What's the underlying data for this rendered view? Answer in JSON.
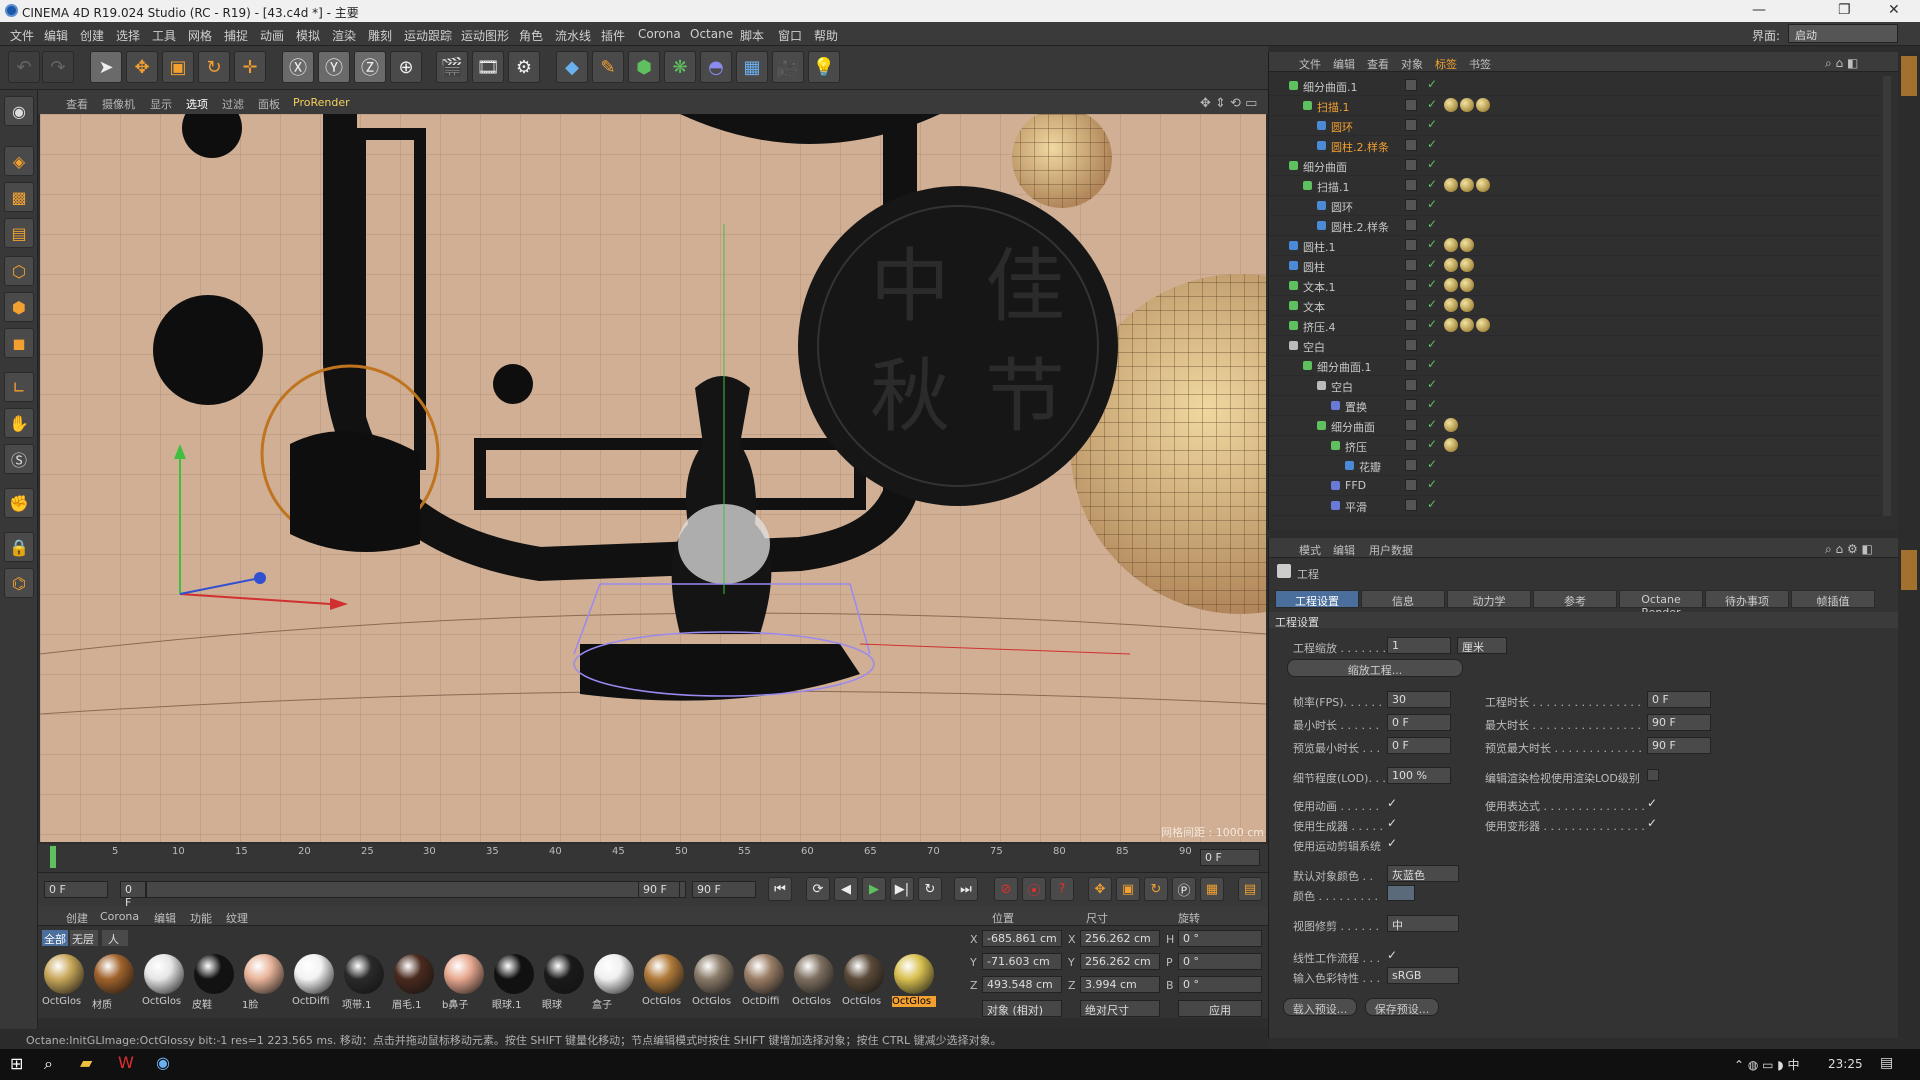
{
  "title": "CINEMA 4D R19.024 Studio (RC - R19) - [43.c4d *] - 主要",
  "window_controls": {
    "minimize": "—",
    "maximize": "❐",
    "close": "✕"
  },
  "menu": {
    "items": [
      "文件",
      "编辑",
      "创建",
      "选择",
      "工具",
      "网格",
      "捕捉",
      "动画",
      "模拟",
      "渲染",
      "雕刻",
      "运动跟踪",
      "运动图形",
      "角色",
      "流水线",
      "插件",
      "Corona",
      "Octane",
      "脚本",
      "窗口",
      "帮助"
    ],
    "layout_label": "界面:",
    "layout_value": "启动"
  },
  "viewport": {
    "menu": [
      "查看",
      "摄像机",
      "显示",
      "选项",
      "过滤",
      "面板",
      "ProRender"
    ],
    "grid_label": "网格间距 : 1000 cm",
    "calligraphy": [
      "中",
      "秋",
      "佳",
      "节"
    ]
  },
  "timeline": {
    "ticks": [
      "0",
      "5",
      "10",
      "15",
      "20",
      "25",
      "30",
      "35",
      "40",
      "45",
      "50",
      "55",
      "60",
      "65",
      "70",
      "75",
      "80",
      "85",
      "90"
    ],
    "current": "0 F"
  },
  "transport": {
    "start": "0 F",
    "range_start": "0 F",
    "range_end": "90 F",
    "end": "90 F"
  },
  "materials": {
    "menu": [
      "创建",
      "Corona",
      "编辑",
      "功能",
      "纹理"
    ],
    "filters": [
      "全部",
      "无层",
      "人"
    ],
    "items": [
      {
        "label": "OctGlos",
        "color": "#c8a85a"
      },
      {
        "label": "材质",
        "color": "#a0622a"
      },
      {
        "label": "OctGlos",
        "color": "#e6e6e6"
      },
      {
        "label": "皮鞋",
        "color": "#121212"
      },
      {
        "label": "1脸",
        "color": "#e8b49a"
      },
      {
        "label": "OctDiffi",
        "color": "#f2f2f2"
      },
      {
        "label": "项带.1",
        "color": "#2a2a2a"
      },
      {
        "label": "眉毛.1",
        "color": "#4a2a1e"
      },
      {
        "label": "b鼻子",
        "color": "#e8a890"
      },
      {
        "label": "眼球.1",
        "color": "#111111"
      },
      {
        "label": "眼球",
        "color": "#1a1a1a"
      },
      {
        "label": "盒子",
        "color": "#f0f0f0"
      },
      {
        "label": "OctGlos",
        "color": "#b07a3a"
      },
      {
        "label": "OctGlos",
        "color": "#8a7a68"
      },
      {
        "label": "OctDiffi",
        "color": "#9a7e66"
      },
      {
        "label": "OctGlos",
        "color": "#7e7060"
      },
      {
        "label": "OctGlos",
        "color": "#5a4a38"
      },
      {
        "label": "OctGlos",
        "color": "#d8c050"
      }
    ]
  },
  "coords": {
    "headers": [
      "位置",
      "尺寸",
      "旋转"
    ],
    "pos": {
      "X": "-685.861 cm",
      "Y": "-71.603 cm",
      "Z": "493.548 cm"
    },
    "size": {
      "X": "256.262 cm",
      "Y": "256.262 cm",
      "Z": "3.994 cm"
    },
    "rot": {
      "H": "0 °",
      "P": "0 °",
      "B": "0 °"
    },
    "mode1": "对象 (相对)",
    "mode2": "绝对尺寸",
    "apply": "应用"
  },
  "status": "Octane:InitGLImage:OctGlossy  bit:-1 res=1  223.565 ms.       移动：点击并拖动鼠标移动元素。按住 SHIFT 键量化移动；节点编辑模式时按住 SHIFT 键增加选择对象；按住 CTRL 键减少选择对象。",
  "objects": {
    "menu": [
      "文件",
      "编辑",
      "查看",
      "对象",
      "标签",
      "书签"
    ],
    "rows": [
      {
        "name": "细分曲面.1",
        "indent": 0,
        "color": "#5ec05e",
        "tags": 0,
        "sel": false
      },
      {
        "name": "扫描.1",
        "indent": 1,
        "color": "#5ec05e",
        "tags": 3,
        "sel": true
      },
      {
        "name": "圆环",
        "indent": 2,
        "color": "#4a8ad8",
        "tags": 0,
        "sel": true
      },
      {
        "name": "圆柱.2.样条",
        "indent": 2,
        "color": "#4a8ad8",
        "tags": 0,
        "sel": true
      },
      {
        "name": "细分曲面",
        "indent": 0,
        "color": "#5ec05e",
        "tags": 0,
        "sel": false
      },
      {
        "name": "扫描.1",
        "indent": 1,
        "color": "#5ec05e",
        "tags": 3,
        "sel": false
      },
      {
        "name": "圆环",
        "indent": 2,
        "color": "#4a8ad8",
        "tags": 0,
        "sel": false
      },
      {
        "name": "圆柱.2.样条",
        "indent": 2,
        "color": "#4a8ad8",
        "tags": 0,
        "sel": false
      },
      {
        "name": "圆柱.1",
        "indent": 0,
        "color": "#4a8ad8",
        "tags": 2,
        "sel": false
      },
      {
        "name": "圆柱",
        "indent": 0,
        "color": "#4a8ad8",
        "tags": 2,
        "sel": false
      },
      {
        "name": "文本.1",
        "indent": 0,
        "color": "#5ec05e",
        "tags": 2,
        "sel": false
      },
      {
        "name": "文本",
        "indent": 0,
        "color": "#5ec05e",
        "tags": 2,
        "sel": false
      },
      {
        "name": "挤压.4",
        "indent": 0,
        "color": "#5ec05e",
        "tags": 3,
        "sel": false
      },
      {
        "name": "空白",
        "indent": 0,
        "color": "#bbbbbb",
        "tags": 0,
        "sel": false
      },
      {
        "name": "细分曲面.1",
        "indent": 1,
        "color": "#5ec05e",
        "tags": 0,
        "sel": false
      },
      {
        "name": "空白",
        "indent": 2,
        "color": "#bbbbbb",
        "tags": 0,
        "sel": false
      },
      {
        "name": "置换",
        "indent": 3,
        "color": "#6a7ad8",
        "tags": 0,
        "sel": false
      },
      {
        "name": "细分曲面",
        "indent": 2,
        "color": "#5ec05e",
        "tags": 1,
        "sel": false
      },
      {
        "name": "挤压",
        "indent": 3,
        "color": "#5ec05e",
        "tags": 1,
        "sel": false
      },
      {
        "name": "花瓣",
        "indent": 4,
        "color": "#4a8ad8",
        "tags": 0,
        "sel": false
      },
      {
        "name": "FFD",
        "indent": 3,
        "color": "#6a7ad8",
        "tags": 0,
        "sel": false
      },
      {
        "name": "平滑",
        "indent": 3,
        "color": "#6a7ad8",
        "tags": 0,
        "sel": false
      }
    ]
  },
  "attributes": {
    "menu": [
      "模式",
      "编辑",
      "用户数据"
    ],
    "object_title": "工程",
    "tabs": [
      "工程设置",
      "信息",
      "动力学",
      "参考",
      "Octane Render",
      "待办事项",
      "帧插值"
    ],
    "section": "工程设置",
    "scale_label": "工程缩放 . . . . . . .",
    "scale_value": "1",
    "scale_unit": "厘米",
    "scale_btn": "缩放工程...",
    "fps_label": "帧率(FPS). . . . . .",
    "fps": "30",
    "min_label": "最小时长 . . . . . .",
    "min": "0 F",
    "pmin_label": "预览最小时长 . . .",
    "pmin": "0 F",
    "len_label": "工程时长 . . . . . . . . . . . . . . . .",
    "len": "0 F",
    "max_label": "最大时长 . . . . . . . . . . . . . . . .",
    "max": "90 F",
    "pmax_label": "预览最大时长 . . . . . . . . . . . . .",
    "pmax": "90 F",
    "lod_label": "细节程度(LOD). . .",
    "lod": "100 %",
    "lod2_label": "编辑渲染检视使用渲染LOD级别",
    "anim_label": "使用动画 . . . . . .",
    "expr_label": "使用表达式 . . . . . . . . . . . . . . .",
    "gen_label": "使用生成器 . . . . .",
    "deform_label": "使用变形器 . . . . . . . . . . . . . . .",
    "mograph_label": "使用运动剪辑系统",
    "defcolor_label": "默认对象颜色 . .",
    "defcolor": "灰蓝色",
    "color_label": "颜色 . . . . . . . . .",
    "clip_label": "视图修剪 . . . . . .",
    "clip": "中",
    "linear_label": "线性工作流程 . . .",
    "input_label": "输入色彩特性 . . .",
    "input": "sRGB",
    "load_btn": "载入预设...",
    "save_btn": "保存预设..."
  },
  "taskbar": {
    "time": "23:25"
  },
  "colors": {
    "accent": "#f2a030",
    "selected_obj": "#f2a030",
    "tab_active": "#4a6f9c"
  }
}
